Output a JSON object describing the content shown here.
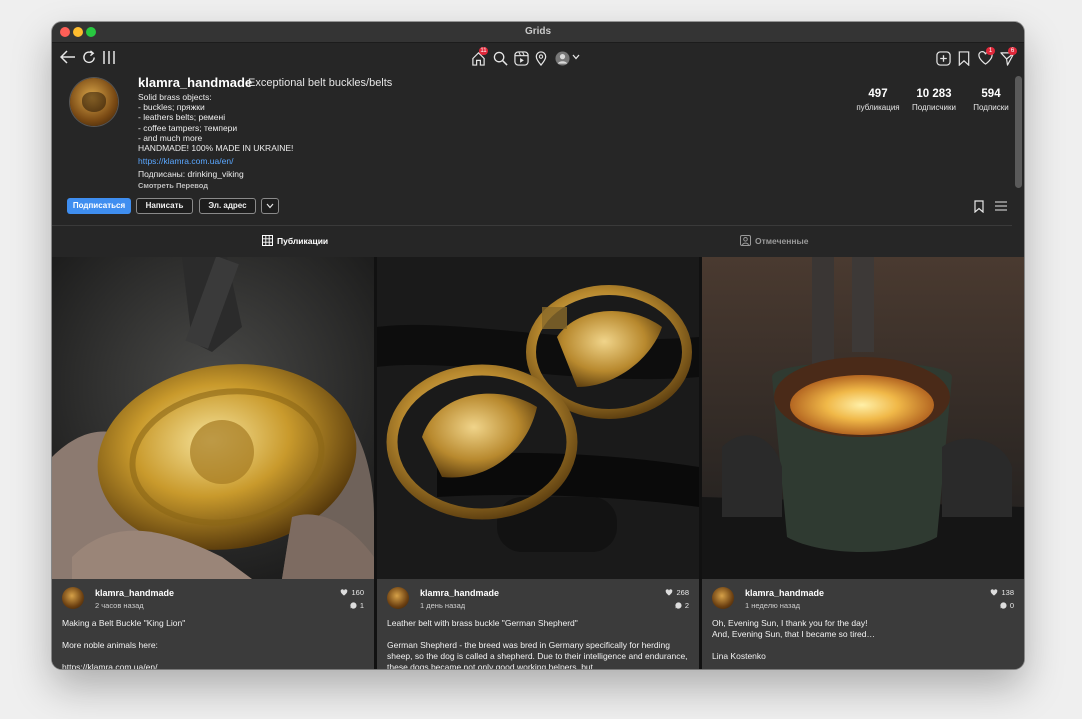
{
  "window": {
    "title": "Grids"
  },
  "toolbar": {
    "left_icons": [
      "back-arrow-icon",
      "refresh-icon",
      "columns-icon"
    ],
    "home_badge": "11",
    "center_icons": [
      "home-icon",
      "search-icon",
      "reels-icon",
      "location-icon",
      "profile-avatar",
      "chevron-down-icon"
    ],
    "right_icons": [
      "add-post-icon",
      "saved-icon",
      "activity-heart-icon",
      "direct-icon"
    ],
    "heart_badge": "1",
    "direct_badge": "6"
  },
  "profile": {
    "username": "klamra_handmade",
    "tagline": "Exceptional belt buckles/belts",
    "bio_lines": "Solid brass objects:\n- buckles; пряжки\n- leathers belts; ремені\n- coffee tampers; темпери\n- and much more\nHANDMADE! 100% MADE IN UKRAINE!",
    "link": "https://klamra.com.ua/en/",
    "followed_by": "Подписаны: drinking_viking",
    "translate": "Смотреть Перевод",
    "buttons": {
      "follow": "Подписаться",
      "message": "Написать",
      "email": "Эл. адрес"
    },
    "stats": [
      {
        "num": "497",
        "label": "публикация"
      },
      {
        "num": "10 283",
        "label": "Подписчики"
      },
      {
        "num": "594",
        "label": "Подписки"
      }
    ]
  },
  "tabs": {
    "posts": "Публикации",
    "tagged": "Отмеченные"
  },
  "posts": [
    {
      "user": "klamra_handmade",
      "time": "2 часов назад",
      "likes": "160",
      "comments": "1",
      "text": "Making a Belt Buckle  \"King Lion\"\n\nMore noble animals here:\n\nhttps://klamra.com.ua/en/"
    },
    {
      "user": "klamra_handmade",
      "time": "1 день назад",
      "likes": "268",
      "comments": "2",
      "text": "Leather belt with brass buckle \"German Shepherd\"\n\nGerman Shepherd - the breed was bred in Germany specifically for herding sheep, so the dog is called a shepherd. Due to their intelligence and endurance, these dogs became not only good working helpers, but"
    },
    {
      "user": "klamra_handmade",
      "time": "1 неделю назад",
      "likes": "138",
      "comments": "0",
      "text": "Oh, Evening Sun, I thank you for the day!\nAnd, Evening Sun, that I became so tired…\n\nLina  Kostenko"
    }
  ]
}
